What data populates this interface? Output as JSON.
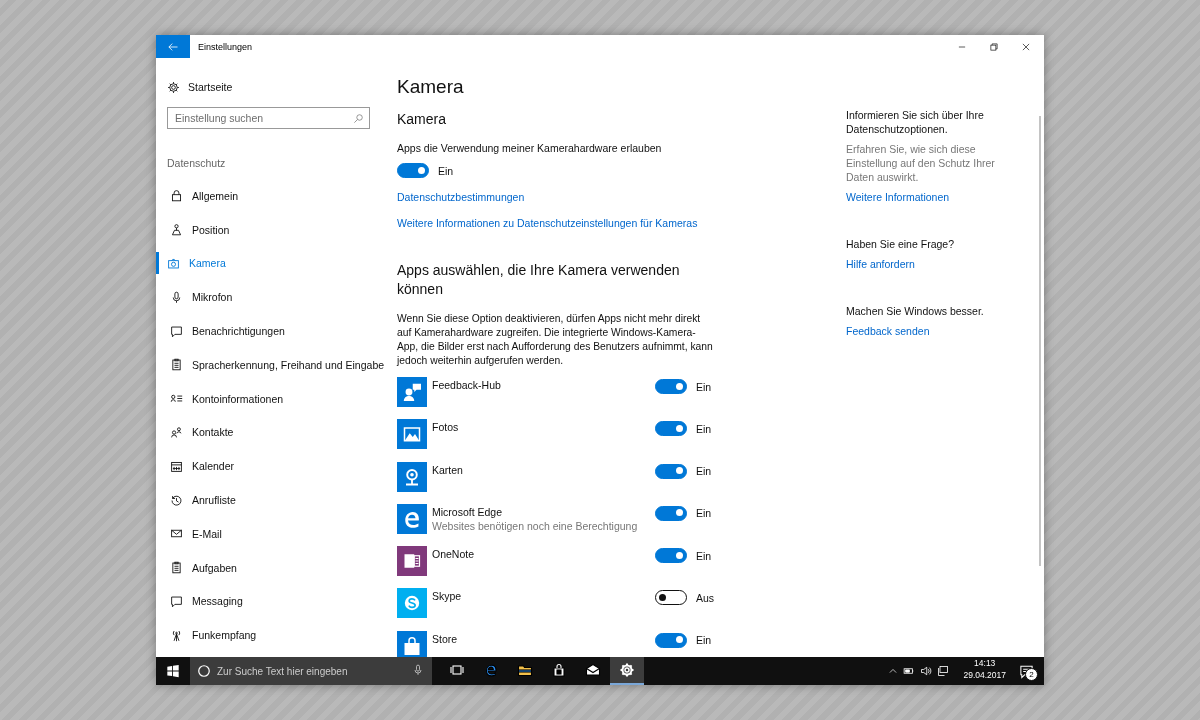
{
  "window": {
    "title": "Einstellungen"
  },
  "sidebar": {
    "home": "Startseite",
    "search": {
      "placeholder": "Einstellung suchen"
    },
    "section": "Datenschutz",
    "items": [
      {
        "label": "Allgemein",
        "kind": "general",
        "selected": false
      },
      {
        "label": "Position",
        "kind": "position",
        "selected": false
      },
      {
        "label": "Kamera",
        "kind": "camera",
        "selected": true
      },
      {
        "label": "Mikrofon",
        "kind": "microphone",
        "selected": false
      },
      {
        "label": "Benachrichtigungen",
        "kind": "notifications",
        "selected": false
      },
      {
        "label": "Spracherkennung, Freihand und Eingabe",
        "kind": "speech",
        "selected": false
      },
      {
        "label": "Kontoinformationen",
        "kind": "account",
        "selected": false
      },
      {
        "label": "Kontakte",
        "kind": "contacts",
        "selected": false
      },
      {
        "label": "Kalender",
        "kind": "calendar",
        "selected": false
      },
      {
        "label": "Anrufliste",
        "kind": "call_history",
        "selected": false
      },
      {
        "label": "E-Mail",
        "kind": "email",
        "selected": false
      },
      {
        "label": "Aufgaben",
        "kind": "tasks",
        "selected": false
      },
      {
        "label": "Messaging",
        "kind": "messaging",
        "selected": false
      },
      {
        "label": "Funkempfang",
        "kind": "radios",
        "selected": false
      }
    ]
  },
  "main": {
    "title": "Kamera",
    "section_title": "Kamera",
    "setting_label": "Apps die Verwendung meiner Kamerahardware erlauben",
    "master_toggle": {
      "on": true,
      "state_label": "Ein"
    },
    "links": [
      "Datenschutzbestimmungen",
      "Weitere Informationen zu Datenschutzeinstellungen für Kameras"
    ],
    "apps_heading": "Apps auswählen, die Ihre Kamera verwenden können",
    "description": "Wenn Sie diese Option deaktivieren, dürfen Apps nicht mehr direkt auf Kamerahardware zugreifen. Die integrierte Windows-Kamera-App, die Bilder erst nach Aufforderung des Benutzers aufnimmt, kann jedoch weiterhin aufgerufen werden.",
    "apps": [
      {
        "name": "Feedback-Hub",
        "kind": "feedback",
        "color": "#0078d7",
        "on": true,
        "state_label": "Ein"
      },
      {
        "name": "Fotos",
        "kind": "photos",
        "color": "#0078d7",
        "on": true,
        "state_label": "Ein"
      },
      {
        "name": "Karten",
        "kind": "maps",
        "color": "#0078d7",
        "on": true,
        "state_label": "Ein"
      },
      {
        "name": "Microsoft Edge",
        "subtitle": "Websites benötigen noch eine Berechtigung",
        "kind": "edge",
        "color": "#0078d7",
        "on": true,
        "state_label": "Ein"
      },
      {
        "name": "OneNote",
        "kind": "notebook",
        "color": "#80397b",
        "on": true,
        "state_label": "Ein"
      },
      {
        "name": "Skype",
        "kind": "skype",
        "color": "#00aff0",
        "on": false,
        "state_label": "Aus"
      },
      {
        "name": "Store",
        "kind": "store",
        "color": "#0078d7",
        "on": true,
        "state_label": "Ein"
      }
    ]
  },
  "info": {
    "sections": [
      {
        "heading": "Informieren Sie sich über Ihre Datenschutzoptionen.",
        "text": "Erfahren Sie, wie sich diese Einstellung auf den Schutz Ihrer Daten auswirkt.",
        "link": "Weitere Informationen"
      },
      {
        "heading": "Haben Sie eine Frage?",
        "link": "Hilfe anfordern"
      },
      {
        "heading": "Machen Sie Windows besser.",
        "link": "Feedback senden"
      }
    ]
  },
  "taskbar": {
    "search": {
      "placeholder": "Zur Suche Text hier eingeben"
    },
    "apps": [
      {
        "kind": "task_view",
        "selected": false
      },
      {
        "kind": "edge",
        "selected": false
      },
      {
        "kind": "explorer",
        "selected": false
      },
      {
        "kind": "store",
        "selected": false
      },
      {
        "kind": "mail",
        "selected": false
      },
      {
        "kind": "settings",
        "selected": true
      }
    ],
    "time": "14:13",
    "date": "29.04.2017",
    "notification_count": "2"
  }
}
